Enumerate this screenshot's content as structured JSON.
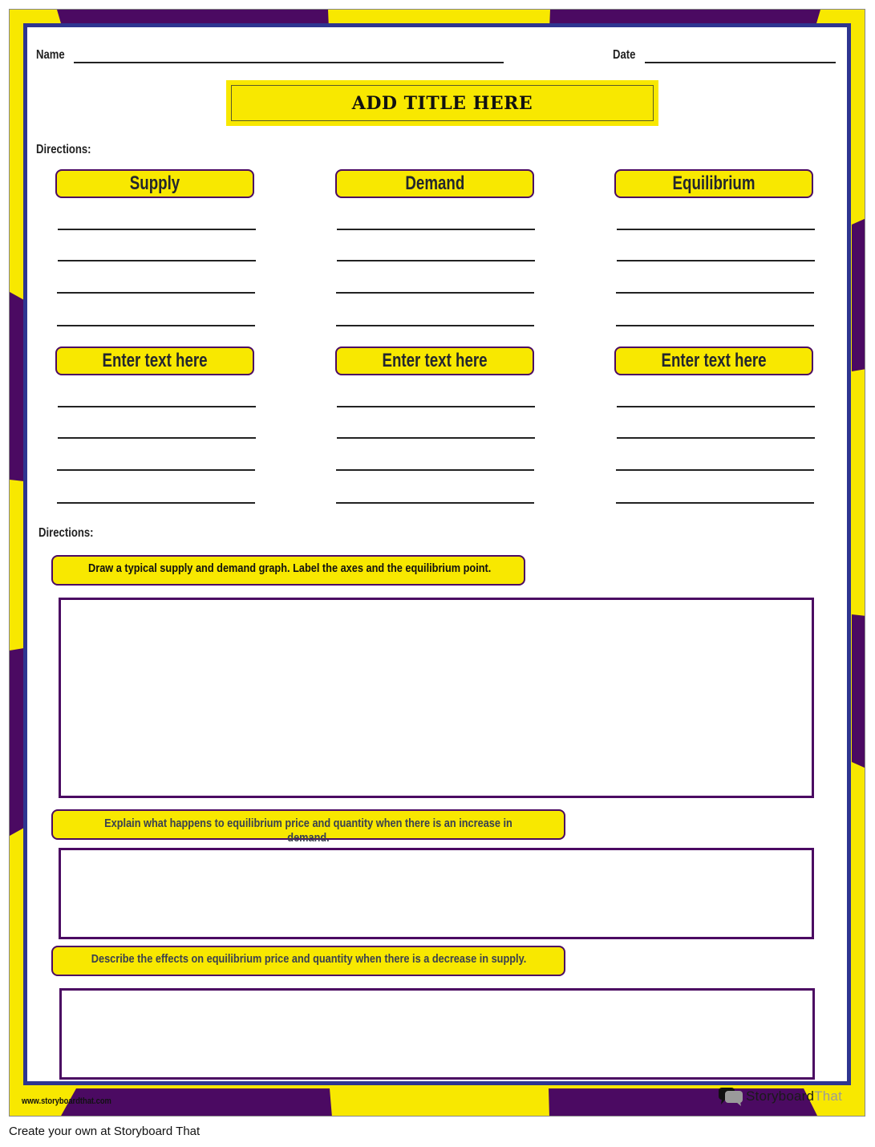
{
  "colors": {
    "yellow": "#f8e800",
    "purple": "#4b0a62",
    "navy": "#2e3590",
    "text_dark": "#23262e",
    "prompt_text_slate": "#3a4050"
  },
  "header": {
    "name_label": "Name",
    "date_label": "Date",
    "title": "ADD TITLE HERE"
  },
  "section1": {
    "directions_label": "Directions:",
    "columns": [
      {
        "heading": "Supply",
        "sub_heading": "Enter text here"
      },
      {
        "heading": "Demand",
        "sub_heading": "Enter text here"
      },
      {
        "heading": "Equilibrium",
        "sub_heading": "Enter text here"
      }
    ]
  },
  "section2": {
    "directions_label": "Directions:",
    "prompts": [
      {
        "text": "Draw a typical supply and demand graph. Label the axes and the equilibrium point."
      },
      {
        "text": "Explain what happens to equilibrium price and quantity when there is an increase in",
        "overflow": "demand."
      },
      {
        "text": "Describe the effects on equilibrium price and quantity when there is a decrease in supply."
      }
    ]
  },
  "footer": {
    "url": "www.storyboardthat.com",
    "logo_part1": "Storyboard",
    "logo_part2": "That",
    "logo_icon": "speech-bubbles-icon",
    "create_text": "Create your own at Storyboard That"
  }
}
